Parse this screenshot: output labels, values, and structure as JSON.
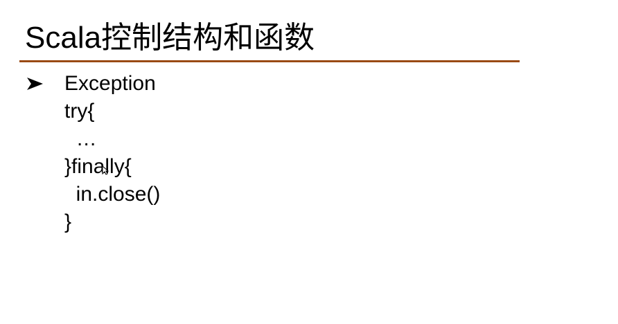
{
  "slide": {
    "title": "Scala控制结构和函数",
    "bullet_icon": "arrowhead-bullet-icon",
    "bullet_text": "Exception",
    "code_lines": [
      "try{",
      "  …",
      "}finally{",
      "  in.close()",
      "}"
    ],
    "colors": {
      "title_rule": "#9a4a14",
      "text": "#000000",
      "background": "#ffffff"
    }
  }
}
